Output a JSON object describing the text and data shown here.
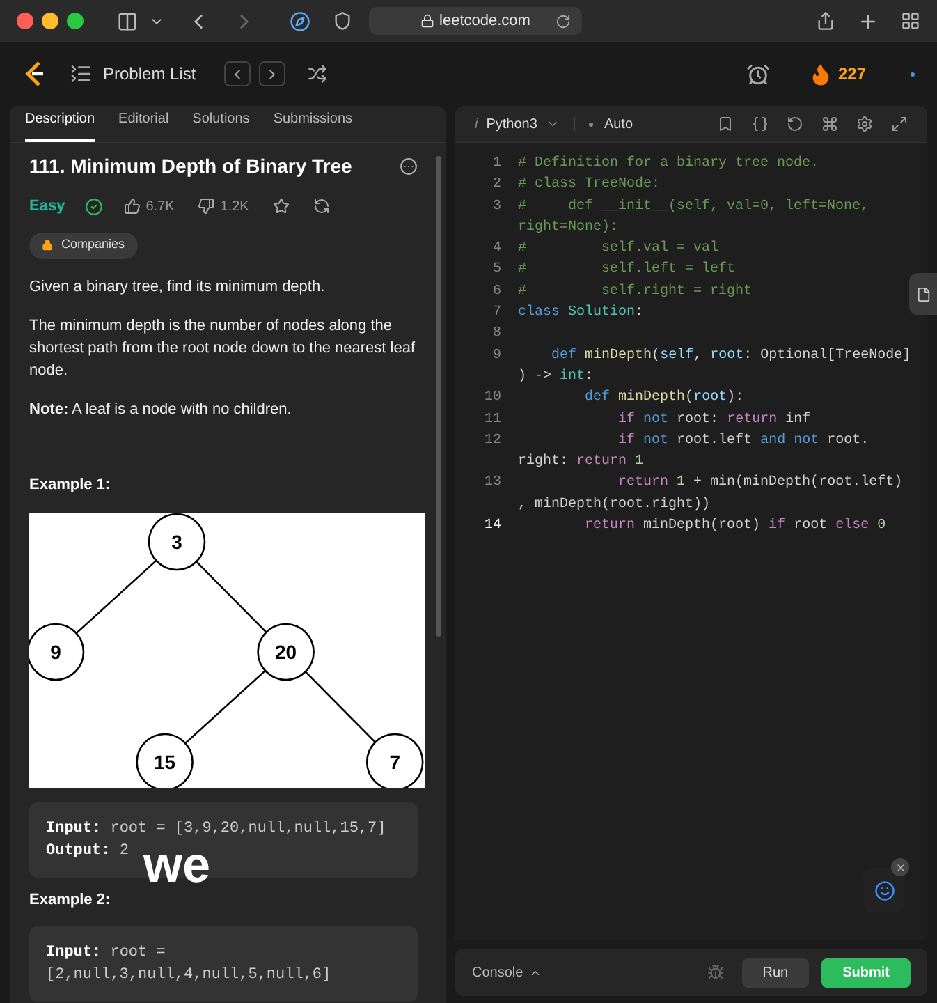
{
  "browser": {
    "url": "leetcode.com"
  },
  "nav": {
    "title": "Problem List",
    "streak": "227"
  },
  "left_tabs": [
    {
      "label": "Description",
      "selected": true
    },
    {
      "label": "Editorial",
      "selected": false
    },
    {
      "label": "Solutions",
      "selected": false
    },
    {
      "label": "Submissions",
      "selected": false
    }
  ],
  "problem": {
    "title": "111. Minimum Depth of Binary Tree",
    "difficulty": "Easy",
    "solved": true,
    "likes": "6.7K",
    "dislikes": "1.2K",
    "tag": "Companies",
    "paragraphs": [
      "Given a binary tree, find its minimum depth.",
      "The minimum depth is the number of nodes along the shortest path from the root node down to the nearest leaf node.",
      "**Note:** A leaf is a node with no children."
    ],
    "examples": [
      {
        "heading": "Example 1:",
        "tree": {
          "value": "3",
          "children": [
            {
              "value": "9"
            },
            {
              "value": "20",
              "children": [
                {
                  "value": "15"
                },
                {
                  "value": "7"
                }
              ]
            }
          ]
        },
        "input_label": "Input:",
        "input": "root = [3,9,20,null,null,15,7]",
        "output_label": "Output:",
        "output": "2"
      },
      {
        "heading": "Example 2:",
        "input_label": "Input:",
        "input": "root = [2,null,3,null,4,null,5,null,6]"
      }
    ]
  },
  "caption": "we",
  "editor": {
    "language_prefix": "i",
    "language": "Python3",
    "mode": "Auto",
    "lines": [
      {
        "number": "1",
        "rows": [
          [
            {
              "kind": "comment",
              "text": "# Definition for a binary tree node."
            }
          ]
        ]
      },
      {
        "number": "2",
        "rows": [
          [
            {
              "kind": "comment",
              "text": "# class TreeNode:"
            }
          ]
        ]
      },
      {
        "number": "3",
        "rows": [
          [
            {
              "kind": "comment",
              "text": "#     def __init__(self, val=0, left=None,"
            }
          ],
          [
            {
              "kind": "comment",
              "text": "right=None):"
            }
          ]
        ]
      },
      {
        "number": "4",
        "rows": [
          [
            {
              "kind": "comment",
              "text": "#         self.val = val"
            }
          ]
        ]
      },
      {
        "number": "5",
        "rows": [
          [
            {
              "kind": "comment",
              "text": "#         self.left = left"
            }
          ]
        ]
      },
      {
        "number": "6",
        "rows": [
          [
            {
              "kind": "comment",
              "text": "#         self.right = right"
            }
          ]
        ]
      },
      {
        "number": "7",
        "rows": [
          [
            {
              "kind": "decl",
              "text": "class "
            },
            {
              "kind": "type",
              "text": "Solution"
            },
            {
              "kind": "plain",
              "text": ":"
            }
          ]
        ]
      },
      {
        "number": "8",
        "rows": [
          []
        ]
      },
      {
        "number": "9",
        "rows": [
          [
            {
              "kind": "plain",
              "text": "    "
            },
            {
              "kind": "decl",
              "text": "def "
            },
            {
              "kind": "func",
              "text": "minDepth"
            },
            {
              "kind": "plain",
              "text": "("
            },
            {
              "kind": "var",
              "text": "self"
            },
            {
              "kind": "plain",
              "text": ", "
            },
            {
              "kind": "var",
              "text": "root"
            },
            {
              "kind": "plain",
              "text": ": Optional[TreeNode]"
            }
          ],
          [
            {
              "kind": "plain",
              "text": ") -> "
            },
            {
              "kind": "type",
              "text": "int"
            },
            {
              "kind": "plain",
              "text": ":"
            }
          ]
        ]
      },
      {
        "number": "10",
        "rows": [
          [
            {
              "kind": "plain",
              "text": "        "
            },
            {
              "kind": "decl",
              "text": "def "
            },
            {
              "kind": "func",
              "text": "minDepth"
            },
            {
              "kind": "plain",
              "text": "("
            },
            {
              "kind": "var",
              "text": "root"
            },
            {
              "kind": "plain",
              "text": "):"
            }
          ]
        ]
      },
      {
        "number": "11",
        "rows": [
          [
            {
              "kind": "plain",
              "text": "            "
            },
            {
              "kind": "control",
              "text": "if "
            },
            {
              "kind": "decl",
              "text": "not "
            },
            {
              "kind": "plain",
              "text": "root: "
            },
            {
              "kind": "control",
              "text": "return "
            },
            {
              "kind": "plain",
              "text": "inf"
            }
          ]
        ]
      },
      {
        "number": "12",
        "rows": [
          [
            {
              "kind": "plain",
              "text": "            "
            },
            {
              "kind": "control",
              "text": "if "
            },
            {
              "kind": "decl",
              "text": "not "
            },
            {
              "kind": "plain",
              "text": "root.left "
            },
            {
              "kind": "decl",
              "text": "and not "
            },
            {
              "kind": "plain",
              "text": "root."
            }
          ],
          [
            {
              "kind": "plain",
              "text": "right: "
            },
            {
              "kind": "control",
              "text": "return "
            },
            {
              "kind": "number",
              "text": "1"
            }
          ]
        ]
      },
      {
        "number": "13",
        "rows": [
          [
            {
              "kind": "plain",
              "text": "            "
            },
            {
              "kind": "control",
              "text": "return "
            },
            {
              "kind": "number",
              "text": "1"
            },
            {
              "kind": "plain",
              "text": " + min(minDepth(root.left)"
            }
          ],
          [
            {
              "kind": "plain",
              "text": ", minDepth(root.right))"
            }
          ]
        ]
      },
      {
        "number": "14",
        "rows": [
          [
            {
              "kind": "plain",
              "text": "        "
            },
            {
              "kind": "control",
              "text": "return "
            },
            {
              "kind": "plain",
              "text": "minDepth(root) "
            },
            {
              "kind": "control",
              "text": "if "
            },
            {
              "kind": "plain",
              "text": "root "
            },
            {
              "kind": "control",
              "text": "else "
            },
            {
              "kind": "number",
              "text": "0"
            }
          ]
        ]
      }
    ]
  },
  "console": {
    "label": "Console",
    "run": "Run",
    "submit": "Submit"
  }
}
